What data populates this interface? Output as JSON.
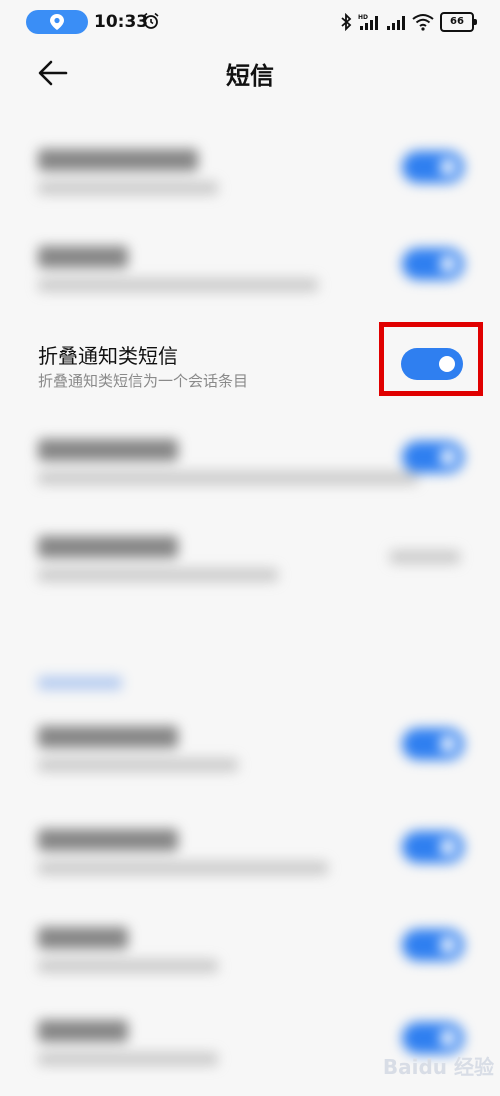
{
  "status_bar": {
    "time": "10:33",
    "battery": "66",
    "icons": [
      "location-icon",
      "alarm-icon",
      "bluetooth-icon",
      "hd-signal-icon",
      "signal-icon",
      "wifi-icon",
      "battery-icon"
    ]
  },
  "header": {
    "title": "短信",
    "back_icon": "back-arrow-icon"
  },
  "highlighted_setting": {
    "title": "折叠通知类短信",
    "subtitle": "折叠通知类短信为一个会话条目",
    "toggle_on": true
  },
  "colors": {
    "accent": "#2f7ff0",
    "highlight_border": "#e00000",
    "background": "#f7f7f7"
  },
  "watermark": "Baidu 经验"
}
